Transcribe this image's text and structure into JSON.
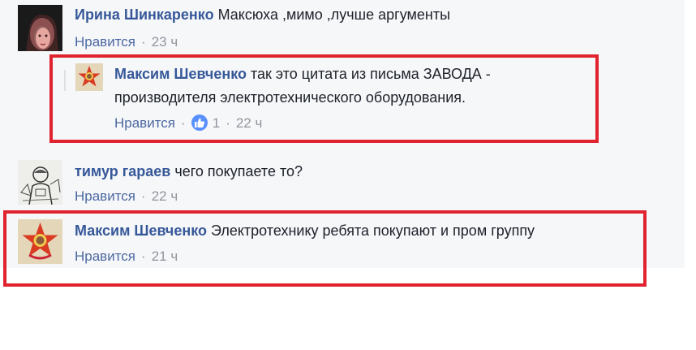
{
  "comments": [
    {
      "author": "Ирина Шинкаренко",
      "text": "Максюха ,мимо ,лучше аргументы",
      "like_label": "Нравится",
      "time": "23 ч",
      "avatar_icon": "woman-portrait-avatar"
    },
    {
      "author": "Максим Шевченко",
      "text_line1": "так это цитата из письма ЗАВОДА -",
      "text_line2": "производителя электротехнического оборудования.",
      "like_label": "Нравится",
      "reaction_icon": "thumbs-up-icon",
      "reaction_count": "1",
      "time": "22 ч",
      "avatar_icon": "pioneer-badge-avatar"
    },
    {
      "author": "тимур гараев",
      "text": "чего покупаете то?",
      "like_label": "Нравится",
      "time": "22 ч",
      "avatar_icon": "sketch-drawing-avatar"
    },
    {
      "author": "Максим Шевченко",
      "text": "Электротехнику ребята покупают и пром группу",
      "like_label": "Нравится",
      "time": "21 ч",
      "avatar_icon": "pioneer-badge-avatar"
    }
  ],
  "separator": "·",
  "colors": {
    "author": "#365899",
    "link": "#4b67a1",
    "meta": "#90949c",
    "highlight": "#e0232e",
    "thread_bg": "#f6f7f9",
    "reaction": "#5890ff"
  }
}
